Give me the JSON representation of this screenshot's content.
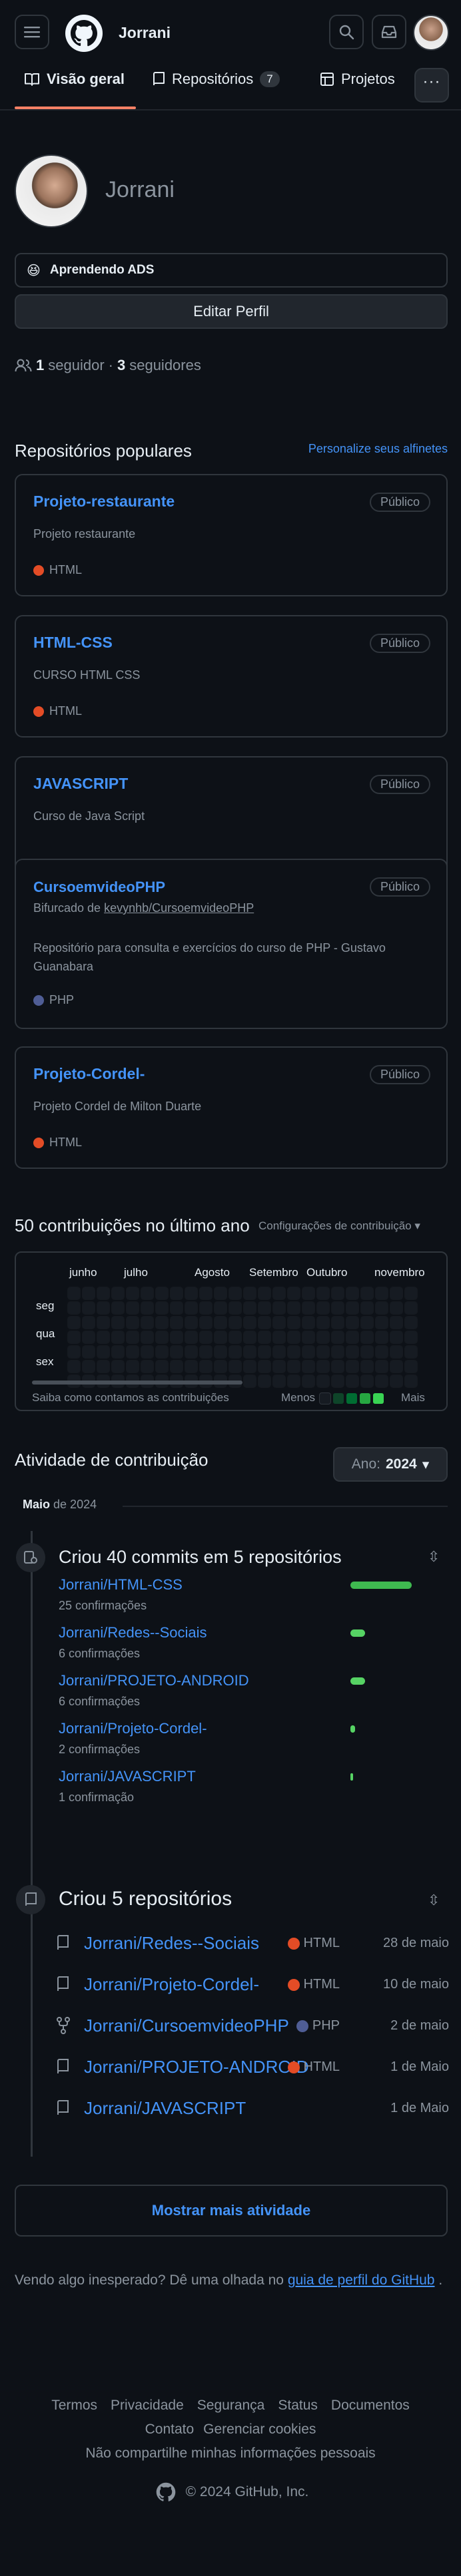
{
  "header": {
    "username": "Jorrani"
  },
  "tabs": [
    {
      "label": "Visão geral"
    },
    {
      "label": "Repositórios",
      "count": "7"
    },
    {
      "label": "Projetos"
    }
  ],
  "profile": {
    "name": "Jorrani",
    "status_emoji": "😆",
    "status_text": "Aprendendo ADS",
    "edit_label": "Editar Perfil",
    "followers_count": "1",
    "followers_label": "seguidor",
    "separator": "·",
    "following_count": "3",
    "following_label": "seguidores"
  },
  "popular": {
    "title": "Repositórios populares",
    "customize": "Personalize seus alfinetes",
    "repos": [
      {
        "name": "Projeto-restaurante",
        "badge": "Público",
        "desc": "Projeto restaurante",
        "lang": "HTML",
        "lang_color": "#e34c26"
      },
      {
        "name": "HTML-CSS",
        "badge": "Público",
        "desc": "CURSO HTML CSS",
        "lang": "HTML",
        "lang_color": "#e34c26"
      },
      {
        "name": "JAVASCRIPT",
        "badge": "Público",
        "desc": "Curso de Java Script",
        "lang": "",
        "lang_color": ""
      },
      {
        "name": "CursoemvideoPHP",
        "badge": "Público",
        "fork_prefix": "Bifurcado de",
        "fork_source": "kevynhb/CursoemvideoPHP",
        "desc": "Repositório para consulta e exercícios do curso de PHP - Gustavo Guanabara",
        "lang": "PHP",
        "lang_color": "#4f5d95"
      },
      {
        "name": "Projeto-Cordel-",
        "badge": "Público",
        "desc": "Projeto Cordel de Milton Duarte",
        "lang": "HTML",
        "lang_color": "#e34c26"
      }
    ]
  },
  "contributions": {
    "title": "50 contribuições no último ano",
    "settings": "Configurações de contribuição",
    "months": [
      "junho",
      "julho",
      "Agosto",
      "Setembro",
      "Outubro",
      "novembro"
    ],
    "days": [
      "seg",
      "qua",
      "sex"
    ],
    "learn": "Saiba como contamos as contribuições",
    "less": "Menos",
    "more": "Mais"
  },
  "activity": {
    "title": "Atividade de contribuição",
    "year_label": "Ano:",
    "year_value": "2024",
    "month_label": "Maio",
    "month_year": "de 2024",
    "commits_title": "Criou 40 commits em 5 repositórios",
    "commit_repos": [
      {
        "name": "Jorrani/HTML-CSS",
        "sub": "25 confirmações",
        "share": 25
      },
      {
        "name": "Jorrani/Redes--Sociais",
        "sub": "6 confirmações",
        "share": 6
      },
      {
        "name": "Jorrani/PROJETO-ANDROID",
        "sub": "6 confirmações",
        "share": 6
      },
      {
        "name": "Jorrani/Projeto-Cordel-",
        "sub": "2 confirmações",
        "share": 2
      },
      {
        "name": "Jorrani/JAVASCRIPT",
        "sub": "1 confirmação",
        "share": 1
      }
    ],
    "created_title": "Criou 5 repositórios",
    "created_repos": [
      {
        "name": "Jorrani/Redes--Sociais",
        "lang": "HTML",
        "lang_color": "#e34c26",
        "date": "28 de maio"
      },
      {
        "name": "Jorrani/Projeto-Cordel-",
        "lang": "HTML",
        "lang_color": "#e34c26",
        "date": "10 de maio"
      },
      {
        "name": "Jorrani/CursoemvideoPHP",
        "lang": "PHP",
        "lang_color": "#4f5d95",
        "date": "2 de maio"
      },
      {
        "name": "Jorrani/PROJETO-ANDROID",
        "lang": "HTML",
        "lang_color": "#e34c26",
        "date": "1 de Maio"
      },
      {
        "name": "Jorrani/JAVASCRIPT",
        "lang": "",
        "lang_color": "",
        "date": "1 de Maio"
      }
    ],
    "show_more": "Mostrar mais atividade"
  },
  "unexpected": {
    "text": "Vendo algo inesperado? Dê uma olhada no",
    "link": "guia de perfil do GitHub",
    "end": "."
  },
  "footer": {
    "links": [
      "Termos",
      "Privacidade",
      "Segurança",
      "Status",
      "Documentos",
      "Contato",
      "Gerenciar cookies",
      "Não compartilhe minhas informações pessoais"
    ],
    "copyright": "© 2024 GitHub, Inc."
  }
}
